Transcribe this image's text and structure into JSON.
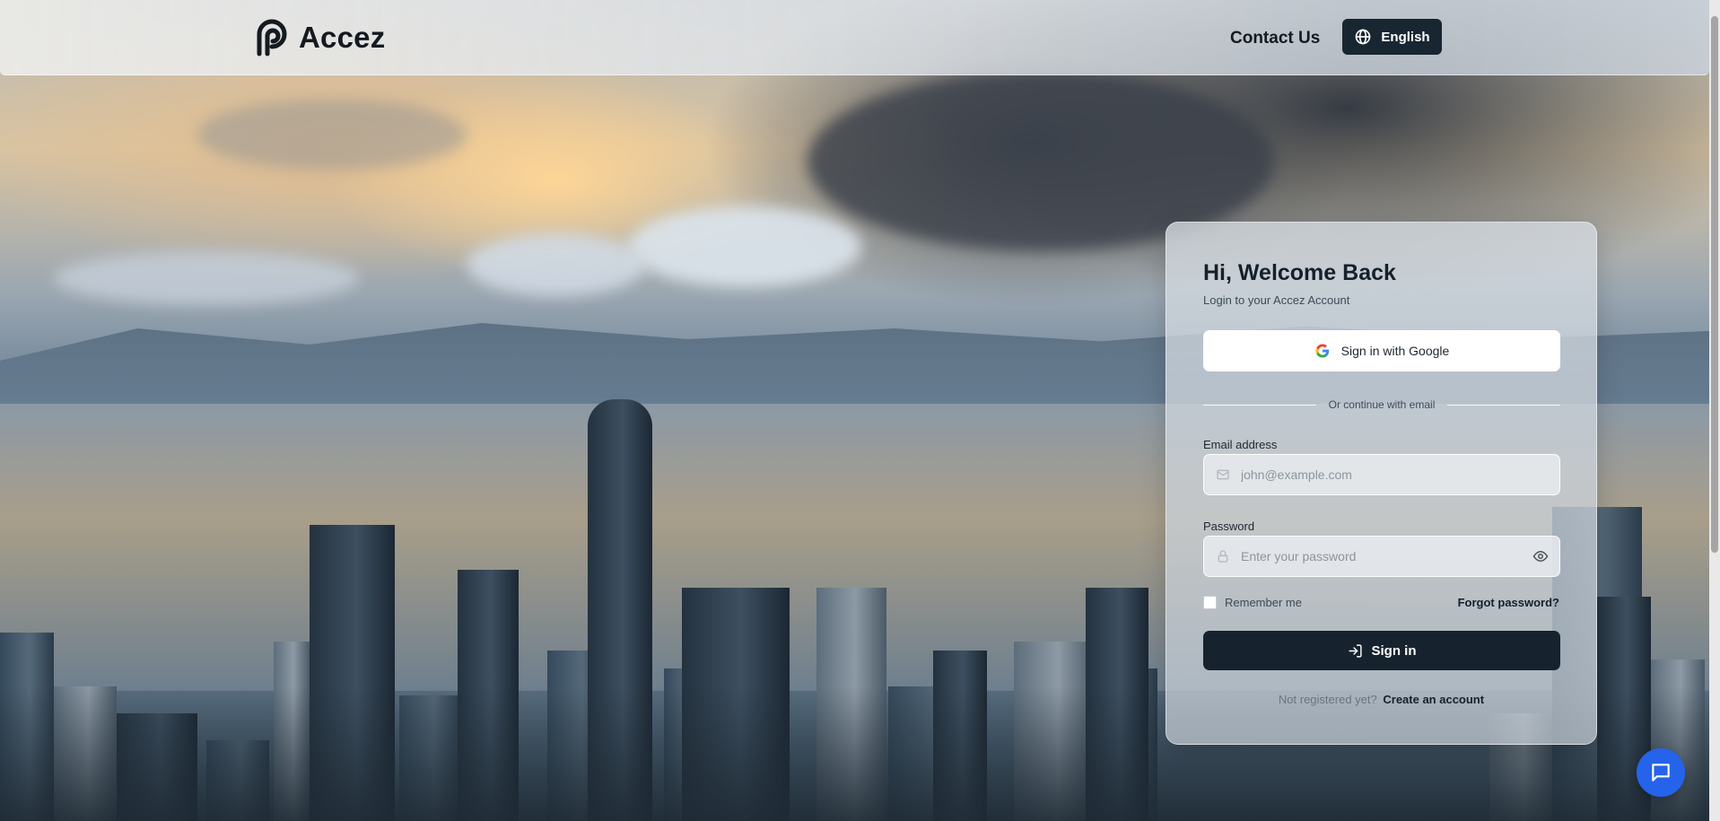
{
  "brand": {
    "name": "Accez"
  },
  "nav": {
    "contact": "Contact Us",
    "language": "English"
  },
  "login": {
    "title": "Hi, Welcome Back",
    "subtitle": "Login to your Accez Account",
    "google": "Sign in with Google",
    "divider": "Or continue with email",
    "email_label": "Email address",
    "email_placeholder": "john@example.com",
    "password_label": "Password",
    "password_placeholder": "Enter your password",
    "remember": "Remember me",
    "forgot": "Forgot password?",
    "submit": "Sign in",
    "register_prompt": "Not registered yet?",
    "register_link": "Create an account"
  },
  "colors": {
    "primary_dark": "#182632",
    "chat_blue": "#2563eb"
  },
  "icons": [
    "accez-logo-icon",
    "globe-icon",
    "google-icon",
    "mail-icon",
    "lock-icon",
    "eye-icon",
    "sign-in-icon",
    "chat-icon"
  ]
}
